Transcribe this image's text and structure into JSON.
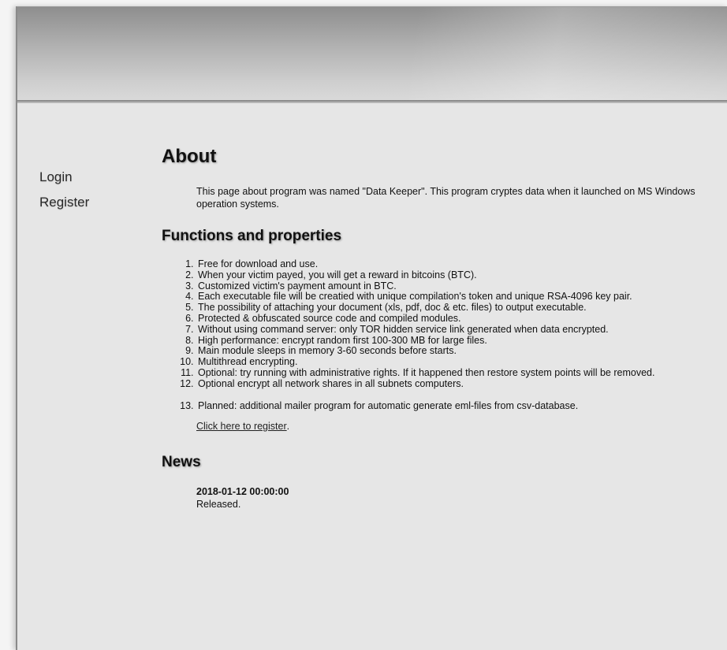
{
  "nav": {
    "login": "Login",
    "register": "Register"
  },
  "about": {
    "title": "About",
    "text": "This page about program was named \"Data Keeper\". This program cryptes data when it launched on MS Windows operation systems."
  },
  "functions": {
    "title": "Functions and properties",
    "items": [
      "Free for download and use.",
      "When your victim payed, you will get a reward in bitcoins (BTC).",
      "Customized victim's payment amount in BTC.",
      "Each executable file will be creatied with unique compilation's token and unique RSA-4096 key pair.",
      "The possibility of attaching your document (xls, pdf, doc & etc. files) to output executable.",
      "Protected & obfuscated source code and compiled modules.",
      "Without using command server: only TOR hidden service link generated when data encrypted.",
      "High performance: encrypt random first 100-300 MB for large files.",
      "Main module sleeps in memory 3-60 seconds before starts.",
      "Multithread encrypting.",
      "Optional: try running with administrative rights. If it happened then restore system points will be removed.",
      "Optional encrypt all network shares in all subnets computers."
    ],
    "planned": "Planned: additional mailer program for automatic generate eml-files from csv-database.",
    "register_link": "Click here to register",
    "register_suffix": "."
  },
  "news": {
    "title": "News",
    "date": "2018-01-12 00:00:00",
    "text": "Released."
  }
}
